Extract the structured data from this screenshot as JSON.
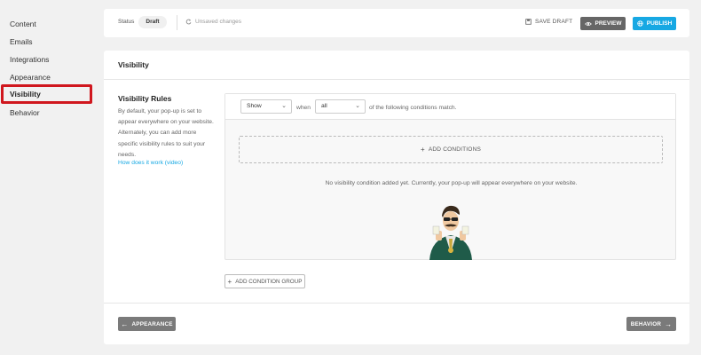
{
  "sidebar": {
    "items": [
      {
        "label": "Content"
      },
      {
        "label": "Emails"
      },
      {
        "label": "Integrations"
      },
      {
        "label": "Appearance"
      },
      {
        "label": "Visibility"
      },
      {
        "label": "Behavior"
      }
    ],
    "active_index": 4,
    "highlight_color": "#d0171e"
  },
  "statusbar": {
    "status_label": "Status",
    "status_value": "Draft",
    "unsaved_text": "Unsaved changes",
    "save_draft_label": "SAVE DRAFT",
    "preview_label": "PREVIEW",
    "publish_label": "PUBLISH",
    "publish_color": "#17a8e3"
  },
  "main": {
    "section_title": "Visibility",
    "rules_title": "Visibility Rules",
    "rules_description": "By default, your pop-up is set to appear everywhere on your website. Alternately, you can add more specific visibility rules to suit your needs.",
    "rules_link": "How does it work (video)",
    "conditions": {
      "action_select": "Show",
      "when_text": "when",
      "match_select": "all",
      "match_text": "of the following conditions match.",
      "add_conditions_label": "ADD CONDITIONS",
      "empty_message": "No visibility condition added yet. Currently, your pop-up will appear everywhere on your website."
    },
    "add_group_label": "ADD CONDITION GROUP",
    "back_button_label": "APPEARANCE",
    "next_button_label": "BEHAVIOR"
  },
  "icons": {
    "unsaved": "refresh-icon",
    "save_draft": "floppy-icon",
    "preview": "eye-icon",
    "publish": "globe-icon",
    "add": "plus-icon",
    "back": "arrow-left-icon",
    "next": "arrow-right-icon"
  }
}
